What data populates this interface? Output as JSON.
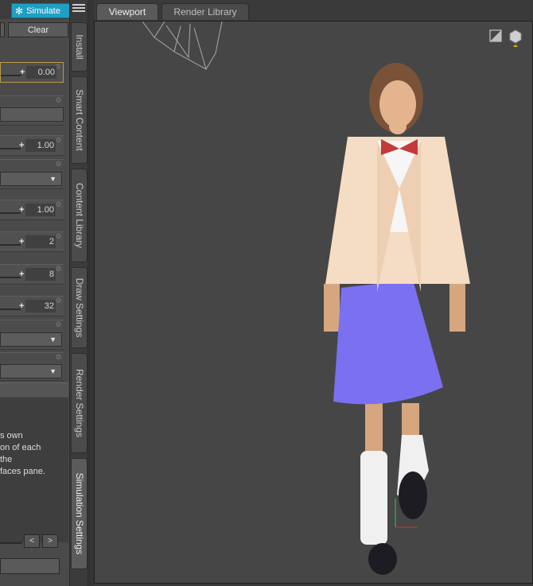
{
  "toolbar": {
    "simulate_label": "Simulate",
    "clear_label": "Clear"
  },
  "settings": {
    "values": [
      "0.00",
      "1.00",
      "1.00",
      "2",
      "8",
      "32"
    ]
  },
  "description": {
    "lines": [
      "s own",
      "on of each",
      " the",
      "faces pane."
    ]
  },
  "nav": {
    "prev": "<",
    "next": ">"
  },
  "side_tabs": [
    "Install",
    "Smart Content",
    "Content Library",
    "Draw Settings",
    "Render Settings",
    "Simulation Settings"
  ],
  "view_tabs": {
    "viewport": "Viewport",
    "render_library": "Render Library"
  },
  "colors": {
    "accent": "#1f9fc4",
    "skirt": "#7b70f0",
    "blazer": "#f5dcc4"
  }
}
